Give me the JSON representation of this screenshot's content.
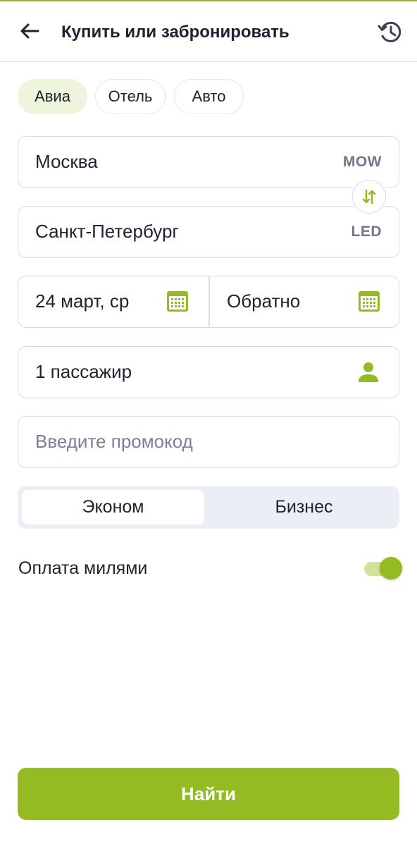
{
  "header": {
    "title": "Купить или забронировать"
  },
  "tabs": [
    {
      "label": "Авиа",
      "active": true
    },
    {
      "label": "Отель",
      "active": false
    },
    {
      "label": "Авто",
      "active": false
    }
  ],
  "route": {
    "from": {
      "city": "Москва",
      "code": "MOW"
    },
    "to": {
      "city": "Санкт-Петербург",
      "code": "LED"
    }
  },
  "dates": {
    "departure": "24 март, ср",
    "return_placeholder": "Обратно"
  },
  "passengers": {
    "value": "1 пассажир"
  },
  "promo": {
    "placeholder": "Введите промокод"
  },
  "cabin_class": {
    "options": [
      "Эконом",
      "Бизнес"
    ],
    "selected": "Эконом"
  },
  "miles": {
    "label": "Оплата милями",
    "enabled": true
  },
  "search_button": {
    "label": "Найти"
  },
  "colors": {
    "accent": "#95bb22",
    "accent_light": "#eef5dc",
    "text": "#1e2230",
    "muted": "#7b8194",
    "border": "#d7dbe2"
  },
  "icons": {
    "back": "arrow-left-icon",
    "history": "history-icon",
    "swap": "swap-vertical-icon",
    "calendar": "calendar-icon",
    "passenger": "person-icon"
  }
}
